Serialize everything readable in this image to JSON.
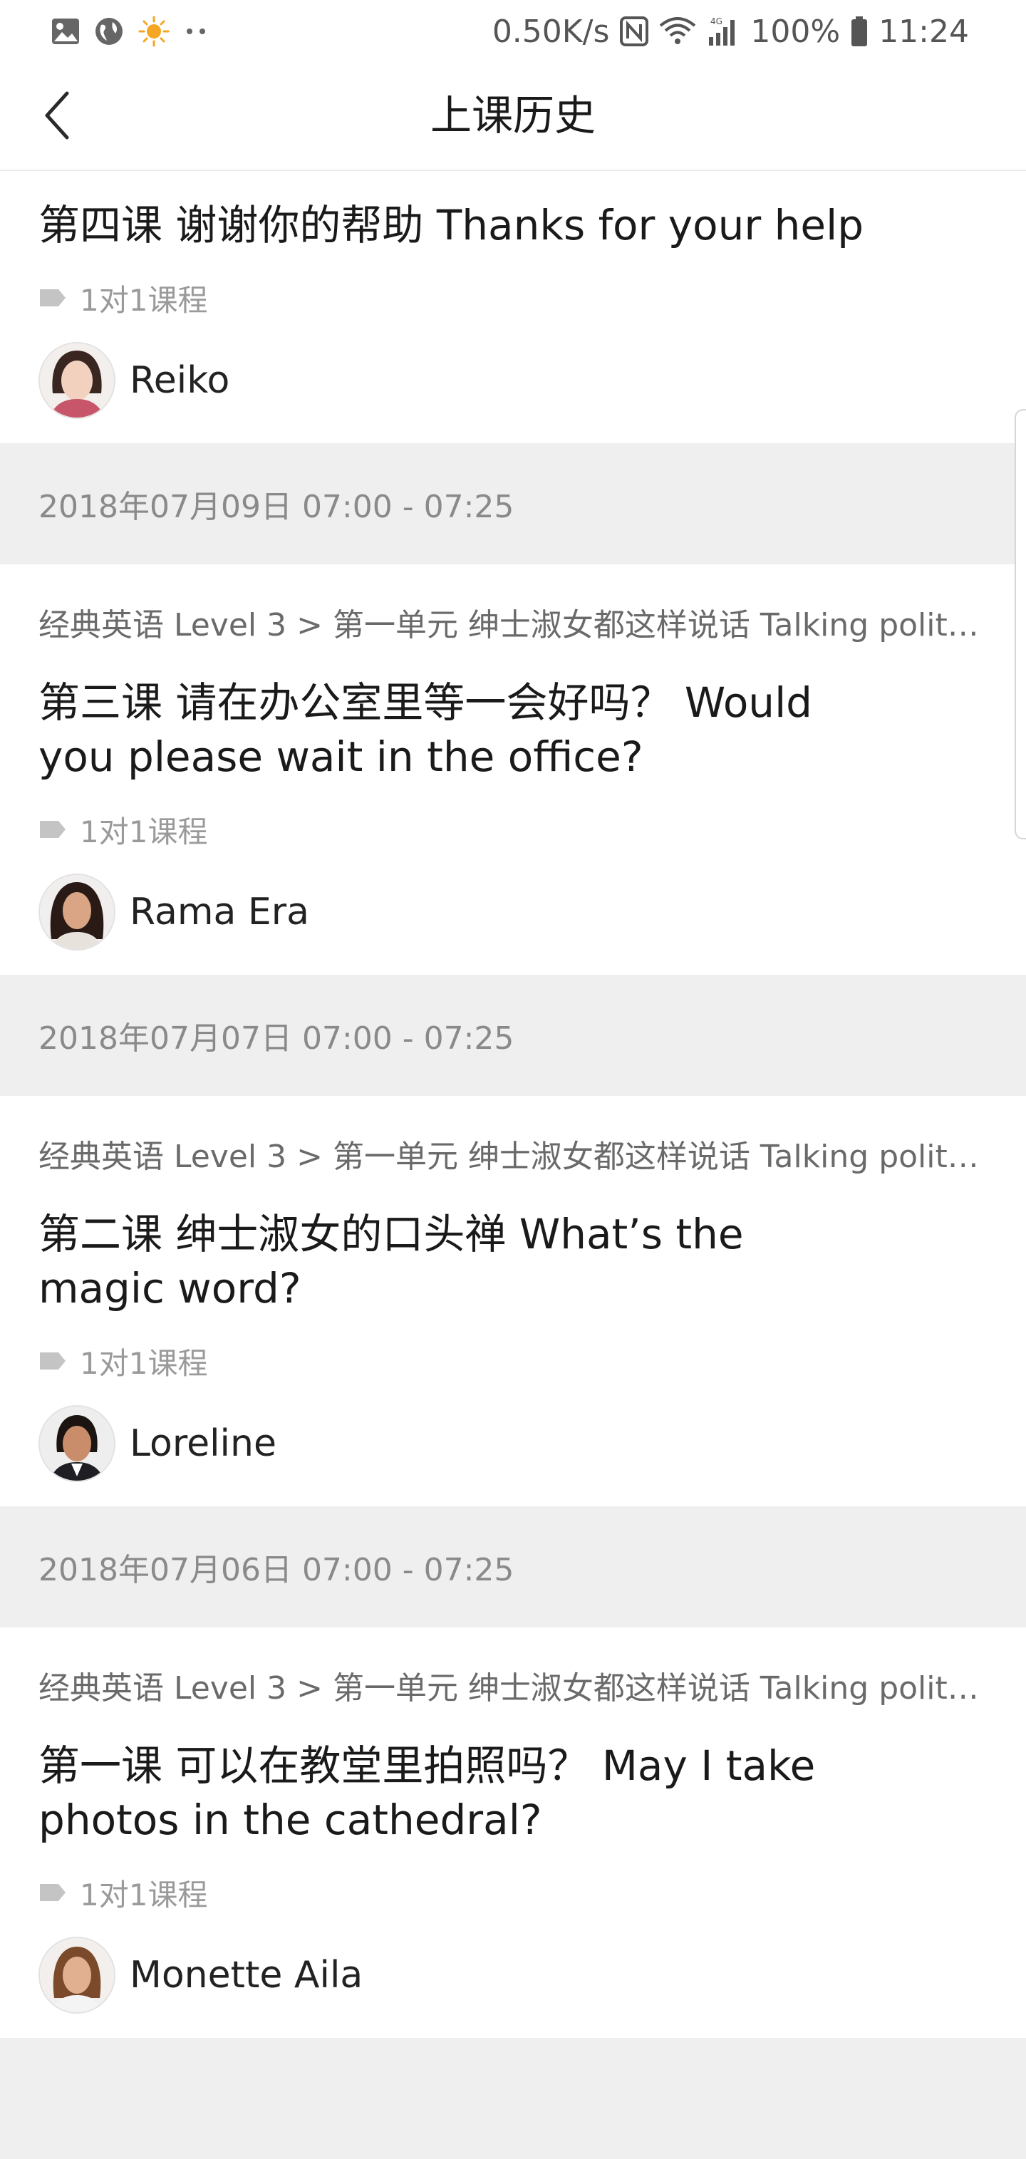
{
  "status_bar": {
    "left_icons": [
      "image-icon",
      "globe-icon",
      "sun-icon",
      "more-dots-icon"
    ],
    "net_speed": "0.50K/s",
    "network_label": "4G",
    "battery": "100%",
    "time": "11:24"
  },
  "header": {
    "title": "上课历史",
    "back_icon": "chevron-left-icon"
  },
  "colors": {
    "date_row_bg": "#efefef",
    "tag_gray": "#9a9a9a",
    "title_text": "#1a1a1a"
  },
  "first_card": {
    "title": "第四课 谢谢你的帮助 Thanks for your help",
    "tag": "1对1课程",
    "teacher": "Reiko"
  },
  "lessons": [
    {
      "date": "2018年07月09日 07:00 - 07:25",
      "breadcrumb": "经典英语 Level 3 > 第一单元 绅士淑女都这样说话 Talking politely",
      "title": "第三课 请在办公室里等一会好吗？ Would you please wait in the office?",
      "tag": "1对1课程",
      "teacher": "Rama Era"
    },
    {
      "date": "2018年07月07日 07:00 - 07:25",
      "breadcrumb": "经典英语 Level 3 > 第一单元 绅士淑女都这样说话 Talking politely",
      "title": "第二课  绅士淑女的口头禅 What’s the magic word?",
      "tag": "1对1课程",
      "teacher": "Loreline"
    },
    {
      "date": "2018年07月06日 07:00 - 07:25",
      "breadcrumb": "经典英语 Level 3 > 第一单元 绅士淑女都这样说话 Talking politely",
      "title": "第一课 可以在教堂里拍照吗？ May I take photos in the cathedral?",
      "tag": "1对1课程",
      "teacher": "Monette Aila"
    }
  ]
}
